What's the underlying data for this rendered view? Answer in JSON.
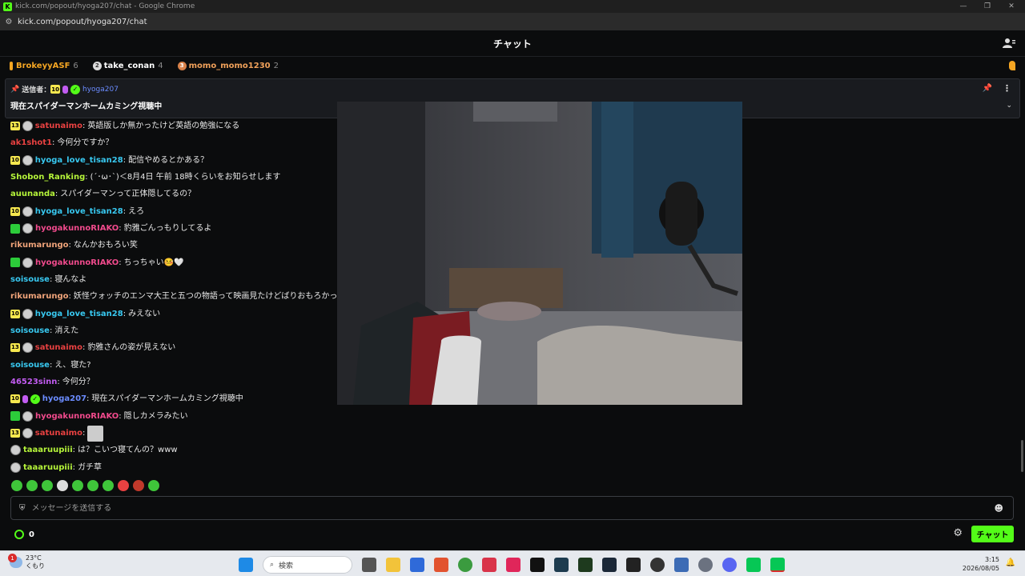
{
  "browser": {
    "window_title": "kick.com/popout/hyoga207/chat - Google Chrome",
    "url": "kick.com/popout/hyoga207/chat"
  },
  "header": {
    "title": "チャット"
  },
  "leaderboard": [
    {
      "name": "BrokeyyASF",
      "count": "6",
      "color": "#f5a623"
    },
    {
      "name": "take_conan",
      "count": "4",
      "color": "#ffffff"
    },
    {
      "name": "momo_momo1230",
      "count": "2",
      "color": "#f0a15a"
    }
  ],
  "pinned": {
    "sender_label": "送信者：",
    "sub_badge": "10",
    "username": "hyoga207",
    "message": "現在スパイダーマンホームカミング視聴中"
  },
  "messages": [
    {
      "sub": "13",
      "avatar": true,
      "user": "satunaimo",
      "color": "#e84141",
      "text": "英語版しか無かったけど英語の勉強になる"
    },
    {
      "user": "ak1shot1",
      "color": "#e84141",
      "text": "今何分ですか？"
    },
    {
      "sub": "10",
      "avatar": true,
      "user": "hyoga_love_tisan28",
      "color": "#38c8f0",
      "text": "配信やめるとかある？"
    },
    {
      "user": "Shobon_Ranking",
      "color": "#b6f53a",
      "text": "(´･ω･`)＜8月4日 午前 18時くらいをお知らせします"
    },
    {
      "user": "auunanda",
      "color": "#b6f53a",
      "text": "スパイダーマンって正体隠してるの？"
    },
    {
      "sub": "10",
      "avatar": true,
      "user": "hyoga_love_tisan28",
      "color": "#38c8f0",
      "text": "えろ"
    },
    {
      "gift": true,
      "avatar": true,
      "user": "hyogakunnoRIAKO",
      "color": "#f04a8c",
      "text": "豹雅ごんっもりしてるよ"
    },
    {
      "user": "rikumarungo",
      "color": "#f0a47a",
      "text": "なんかおもろい笑"
    },
    {
      "gift": true,
      "avatar": true,
      "user": "hyogakunnoRIAKO",
      "color": "#f04a8c",
      "text": "ちっちゃい🤒🤍"
    },
    {
      "user": "soisouse",
      "color": "#38c8f0",
      "text": "寝んなよ"
    },
    {
      "user": "rikumarungo",
      "color": "#f0a47a",
      "text": "妖怪ウォッチのエンマ大王と五つの物語って映画見たけどばりおもろかったよ"
    },
    {
      "sub": "10",
      "avatar": true,
      "user": "hyoga_love_tisan28",
      "color": "#38c8f0",
      "text": "みえない"
    },
    {
      "user": "soisouse",
      "color": "#38c8f0",
      "text": "消えた"
    },
    {
      "sub": "13",
      "avatar": true,
      "user": "satunaimo",
      "color": "#e84141",
      "text": "豹雅さんの姿が見えない"
    },
    {
      "user": "soisouse",
      "color": "#38c8f0",
      "text": "え、寝た?"
    },
    {
      "user": "46523sinn",
      "color": "#c25cf2",
      "text": "今何分？"
    },
    {
      "sub": "10",
      "mic": true,
      "verified": true,
      "user": "hyoga207",
      "color": "#6b8cff",
      "text": "現在スパイダーマンホームカミング視聴中"
    },
    {
      "gift": true,
      "avatar": true,
      "user": "hyogakunnoRIAKO",
      "color": "#f04a8c",
      "text": "隠しカメラみたい"
    },
    {
      "sub": "13",
      "avatar": true,
      "user": "satunaimo",
      "color": "#e84141",
      "text": "",
      "image_emote": true
    },
    {
      "avatar": true,
      "user": "taaaruupiii",
      "color": "#b6f53a",
      "text": "は？こいつ寝てんの？www"
    },
    {
      "avatar": true,
      "user": "taaaruupiii",
      "color": "#b6f53a",
      "text": "ガチ草"
    }
  ],
  "input": {
    "placeholder": "メッセージを送信する"
  },
  "footer": {
    "points": "0",
    "send_label": "チャット"
  },
  "taskbar": {
    "temperature": "23°C",
    "weather": "くもり",
    "search_label": "検索",
    "time": "3:15",
    "date": "2026/08/05",
    "notification_count": "1"
  },
  "colors": {
    "accent": "#53fc18",
    "background": "#0b0c0d"
  }
}
